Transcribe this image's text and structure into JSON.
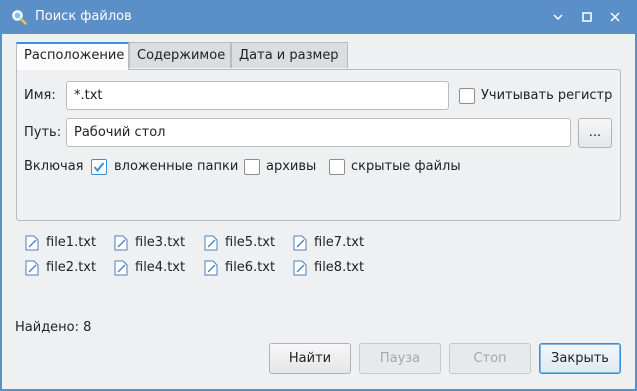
{
  "window": {
    "title": "Поиск файлов",
    "title_icon": "search-icon",
    "controls": [
      "minimize-icon",
      "maximize-icon",
      "close-icon"
    ]
  },
  "tabs": [
    {
      "label": "Расположение",
      "active": true
    },
    {
      "label": "Содержимое",
      "active": false
    },
    {
      "label": "Дата и размер",
      "active": false
    }
  ],
  "location": {
    "name_label": "Имя:",
    "name_value": "*.txt",
    "case_label": "Учитывать регистр",
    "case_checked": false,
    "path_label": "Путь:",
    "path_value": "Рабочий стол",
    "browse_label": "...",
    "include_label": "Включая",
    "subfolders_label": "вложенные папки",
    "subfolders_checked": true,
    "archives_label": "архивы",
    "archives_checked": false,
    "hidden_label": "скрытые файлы",
    "hidden_checked": false
  },
  "results": [
    {
      "name": "file1.txt",
      "icon": "text-file-icon"
    },
    {
      "name": "file2.txt",
      "icon": "text-file-icon"
    },
    {
      "name": "file3.txt",
      "icon": "text-file-icon"
    },
    {
      "name": "file4.txt",
      "icon": "text-file-icon"
    },
    {
      "name": "file5.txt",
      "icon": "text-file-icon"
    },
    {
      "name": "file6.txt",
      "icon": "text-file-icon"
    },
    {
      "name": "file7.txt",
      "icon": "text-file-icon"
    },
    {
      "name": "file8.txt",
      "icon": "text-file-icon"
    }
  ],
  "status": {
    "found": "Найдено: 8"
  },
  "buttons": {
    "find": "Найти",
    "pause": "Пауза",
    "stop": "Стоп",
    "close": "Закрыть"
  },
  "colors": {
    "titlebar": "#5b8fc7",
    "accent": "#3b8fdc",
    "window_bg": "#eff0f1"
  }
}
